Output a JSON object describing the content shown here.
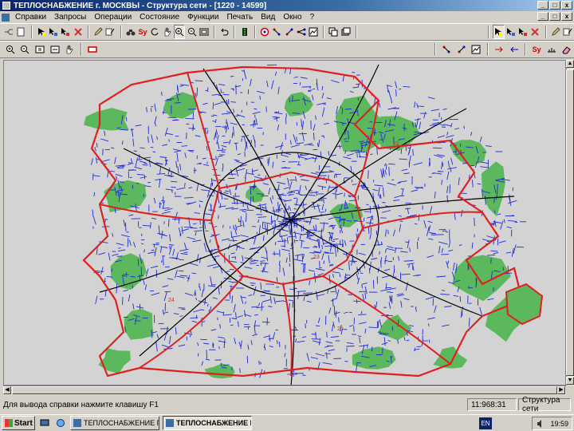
{
  "window": {
    "title": "ТЕПЛОСНАБЖЕНИЕ г. МОСКВЫ - Структура сети - [1220 - 14599]",
    "minimize": "_",
    "maximize": "□",
    "close": "x"
  },
  "menu": {
    "items": [
      "Справки",
      "Запросы",
      "Операции",
      "Состояние",
      "Функции",
      "Печать",
      "Вид",
      "Окно",
      "?"
    ]
  },
  "toolbar": {
    "find_label": "Sy",
    "find_label_2": "Sy"
  },
  "colors": {
    "map_background": "#d3d3d3",
    "green_zones": "#5cb85c",
    "network_lines": "#1f2bd6",
    "district_boundaries": "#e02020",
    "roads": "#000000"
  },
  "map_labels": [
    "22",
    "23",
    "24",
    "25"
  ],
  "statusbar": {
    "help_text": "Для вывода справки нажмите клавишу F1",
    "coords": "11:968:31",
    "layer": "Структура сети"
  },
  "taskbar": {
    "start_label": "Start",
    "task_1": "ТЕПЛОСНАБЖЕНИЕ Г. ...",
    "task_2": "ТЕПЛОСНАБЖЕНИЕ Г. ...",
    "language": "EN",
    "clock": "19:59"
  }
}
